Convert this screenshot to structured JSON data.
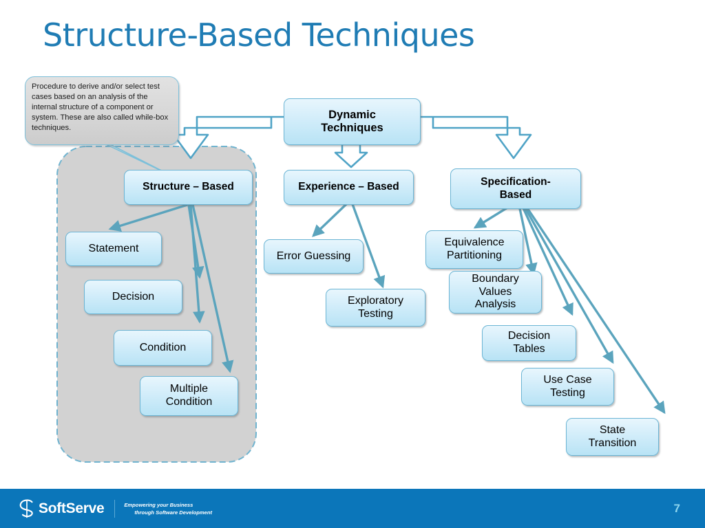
{
  "slide": {
    "title": "Structure-Based Techniques",
    "title_color": "#1f7cb4",
    "background_color": "#ffffff",
    "page_number": "7"
  },
  "note": {
    "line1": "Procedure to derive and/or",
    "line2": "select test cases based on an",
    "line3": "analysis of the internal structure",
    "line4": "of a component or system. These",
    "line5": "are also called while-box",
    "line6": "techniques."
  },
  "diagram": {
    "root": {
      "label": "Dynamic\nTechniques",
      "line1": "Dynamic",
      "line2": "Techniques"
    },
    "branches": [
      {
        "id": "structure",
        "line1": "Structure – Based",
        "line2": ""
      },
      {
        "id": "experience",
        "line1": "Experience – Based",
        "line2": ""
      },
      {
        "id": "specification",
        "line1": "Specification-",
        "line2": "Based"
      }
    ],
    "structure_children": [
      {
        "line1": "Statement",
        "line2": ""
      },
      {
        "line1": "Decision",
        "line2": ""
      },
      {
        "line1": "Condition",
        "line2": ""
      },
      {
        "line1": "Multiple",
        "line2": "Condition"
      }
    ],
    "experience_children": [
      {
        "line1": "Error Guessing",
        "line2": ""
      },
      {
        "line1": "Exploratory",
        "line2": "Testing"
      }
    ],
    "specification_children": [
      {
        "line1": "Equivalence",
        "line2": "Partitioning"
      },
      {
        "line1": "Boundary",
        "line2": "Values",
        "line3": "Analysis"
      },
      {
        "line1": "Decision",
        "line2": "Tables"
      },
      {
        "line1": "Use Case",
        "line2": "Testing"
      },
      {
        "line1": "State",
        "line2": "Transition"
      }
    ],
    "highlight_panel": {
      "fill": "#d2d2d2",
      "border": "#6fb3cf",
      "border_style": "dashed"
    },
    "box_fill_top": "#e8f6fd",
    "box_fill_bottom": "#b8e3f5",
    "box_border": "#6ab4d4",
    "arrow_color": "#5ba4bd",
    "block_arrow_border": "#4fa3c6",
    "block_arrow_fill": "#ffffff"
  },
  "footer": {
    "background": "#0b76ba",
    "brand": "SoftServe",
    "logo_icon": "softserve-s-mark",
    "tagline_line1": "Empowering your Business",
    "tagline_line2": "through Software Development"
  }
}
